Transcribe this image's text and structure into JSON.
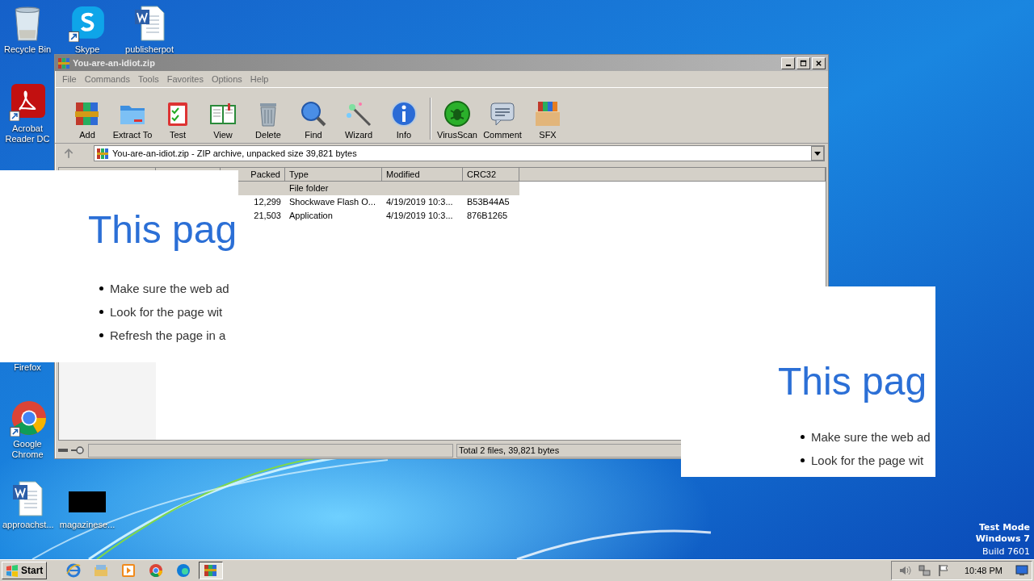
{
  "desktop_icons": [
    {
      "label": "Recycle Bin",
      "kind": "recycle"
    },
    {
      "label": "Skype",
      "kind": "skype"
    },
    {
      "label": "publisherpot",
      "kind": "word"
    },
    {
      "label": "Acrobat Reader DC",
      "kind": "acrobat"
    },
    {
      "label": "Firefox",
      "kind": "hidden"
    },
    {
      "label": "Google Chrome",
      "kind": "chrome"
    },
    {
      "label": "approachst...",
      "kind": "word"
    },
    {
      "label": "magazinese...",
      "kind": "thumbnail"
    }
  ],
  "window": {
    "title": "You-are-an-idiot.zip",
    "menu": [
      "File",
      "Commands",
      "Tools",
      "Favorites",
      "Options",
      "Help"
    ],
    "toolbar": [
      {
        "label": "Add",
        "kind": "add",
        "separator": false
      },
      {
        "label": "Extract To",
        "kind": "extract",
        "separator": false
      },
      {
        "label": "Test",
        "kind": "test",
        "separator": false
      },
      {
        "label": "View",
        "kind": "view",
        "separator": false
      },
      {
        "label": "Delete",
        "kind": "delete",
        "separator": false
      },
      {
        "label": "Find",
        "kind": "find",
        "separator": false
      },
      {
        "label": "Wizard",
        "kind": "wizard",
        "separator": false
      },
      {
        "label": "Info",
        "kind": "info",
        "separator": false
      },
      {
        "label": "VirusScan",
        "kind": "virus",
        "separator": true
      },
      {
        "label": "Comment",
        "kind": "comment",
        "separator": false
      },
      {
        "label": "SFX",
        "kind": "sfx",
        "separator": false
      }
    ],
    "address": "You-are-an-idiot.zip - ZIP archive, unpacked size 39,821 bytes",
    "columns": [
      "Packed",
      "Type",
      "Modified",
      "CRC32"
    ],
    "rows": [
      {
        "type": "File folder",
        "selected": true
      },
      {
        "packed": "12,299",
        "type": "Shockwave Flash O...",
        "modified": "4/19/2019 10:3...",
        "crc32": "B53B44A5",
        "selected": false
      },
      {
        "packed": "21,503",
        "type": "Application",
        "modified": "4/19/2019 10:3...",
        "crc32": "876B1265",
        "selected": false
      }
    ],
    "status": "Total 2 files, 39,821 bytes"
  },
  "error_pages": [
    {
      "heading": "This pag",
      "bullets": [
        "Make sure the web ad",
        "Look for the page wit",
        "Refresh the page in a"
      ]
    },
    {
      "heading": "This pag",
      "bullets": [
        "Make sure the web ad",
        "Look for the page wit"
      ]
    }
  ],
  "system_notice": [
    "Test Mode",
    "Windows 7",
    "Build 7601"
  ],
  "taskbar": {
    "start": "Start",
    "apps": [
      {
        "kind": "ie",
        "selected": false
      },
      {
        "kind": "explorer",
        "selected": false
      },
      {
        "kind": "media",
        "selected": false
      },
      {
        "kind": "chrome",
        "selected": false
      },
      {
        "kind": "edge",
        "selected": false
      },
      {
        "kind": "winrar",
        "selected": true
      }
    ],
    "clock": "10:48 PM"
  }
}
